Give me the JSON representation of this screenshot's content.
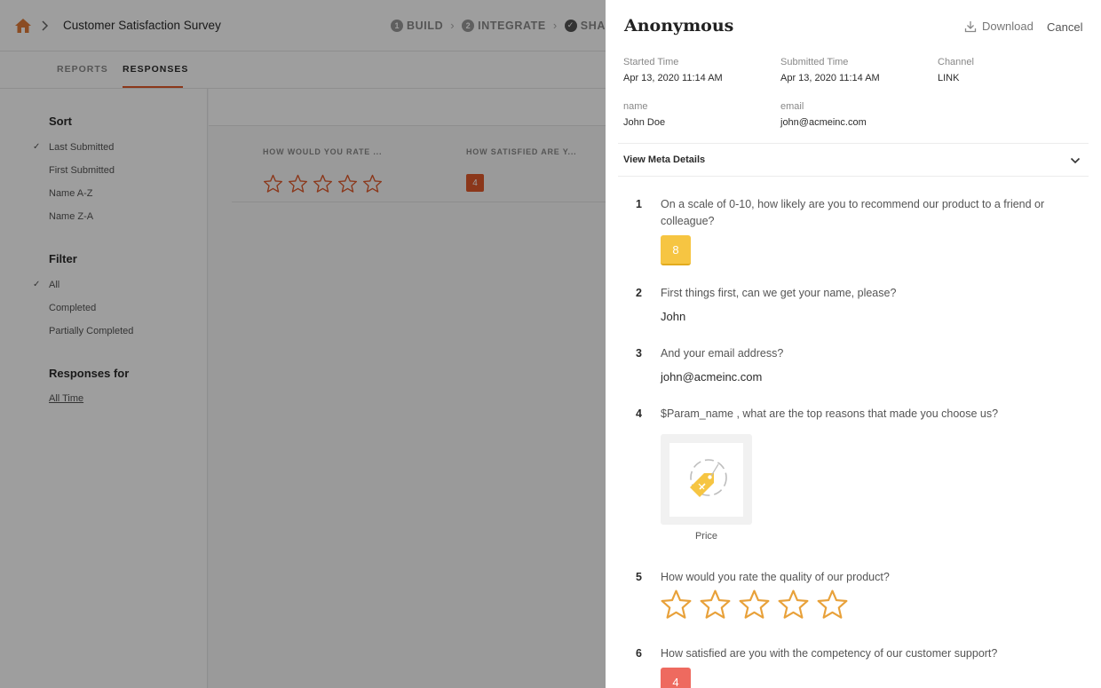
{
  "header": {
    "survey_title": "Customer Satisfaction Survey",
    "steps": [
      {
        "num": "1",
        "label": "BUILD"
      },
      {
        "num": "2",
        "label": "INTEGRATE"
      },
      {
        "num": "",
        "label": "SHA"
      }
    ]
  },
  "tabs": {
    "reports": "REPORTS",
    "responses": "RESPONSES"
  },
  "sidebar": {
    "sort_heading": "Sort",
    "sort_options": [
      "Last Submitted",
      "First Submitted",
      "Name A-Z",
      "Name Z-A"
    ],
    "filter_heading": "Filter",
    "filter_options": [
      "All",
      "Completed",
      "Partially Completed"
    ],
    "responses_for_heading": "Responses for",
    "responses_for_link": "All Time"
  },
  "table": {
    "col1_header": "HOW WOULD YOU RATE ...",
    "col2_header": "HOW SATISFIED ARE Y...",
    "row1_rating_stars": 5,
    "row1_satisfaction": "4"
  },
  "drawer": {
    "title": "Anonymous",
    "download_label": "Download",
    "cancel_label": "Cancel",
    "meta": {
      "started_label": "Started Time",
      "started_value": "Apr 13, 2020 11:14 AM",
      "submitted_label": "Submitted Time",
      "submitted_value": "Apr 13, 2020 11:14 AM",
      "channel_label": "Channel",
      "channel_value": "LINK",
      "name_label": "name",
      "name_value": "John Doe",
      "email_label": "email",
      "email_value": "john@acmeinc.com"
    },
    "meta_toggle": "View Meta Details",
    "questions": [
      {
        "num": "1",
        "text": "On a scale of 0-10, how likely are you to recommend our product to a friend or colleague?",
        "answer": "8"
      },
      {
        "num": "2",
        "text": "First things first, can we get your name, please?",
        "answer": "John"
      },
      {
        "num": "3",
        "text": "And your email address?",
        "answer": "john@acmeinc.com"
      },
      {
        "num": "4",
        "text": "$Param_name , what are the top reasons that made you choose us?",
        "answer": "Price"
      },
      {
        "num": "5",
        "text": "How would you rate the quality of our product?",
        "answer_stars": 5
      },
      {
        "num": "6",
        "text": "How satisfied are you with the competency of our customer support?",
        "answer": "4"
      }
    ]
  },
  "colors": {
    "accent": "#e05a2b",
    "nps_yellow": "#f6c542",
    "star_orange": "#e8a13a",
    "sat_red": "#ee6a5f"
  }
}
